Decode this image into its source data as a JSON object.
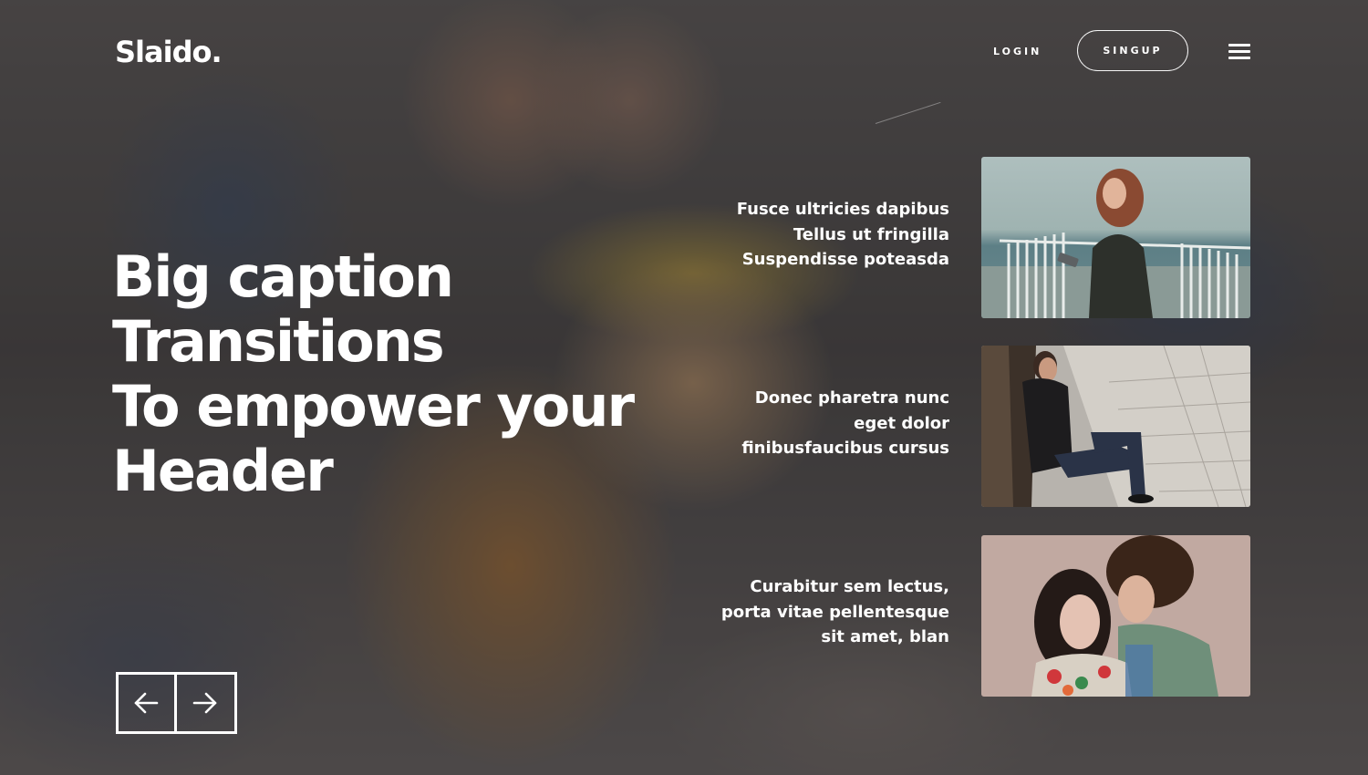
{
  "header": {
    "logo": "Slaido.",
    "login_label": "LOGIN",
    "signup_label": "SINGUP",
    "menu_icon": "hamburger-menu-icon"
  },
  "hero": {
    "lines": [
      "Big caption",
      "Transitions",
      "To empower your",
      "Header"
    ]
  },
  "slides": [
    {
      "caption": [
        "Fusce ultricies dapibus",
        "Tellus ut fringilla",
        "Suspendisse poteasda"
      ],
      "image": "woman-by-sea-photo"
    },
    {
      "caption": [
        "Donec pharetra nunc",
        "eget dolor",
        "finibusfaucibus cursus"
      ],
      "image": "man-sitting-on-pavement-photo"
    },
    {
      "caption": [
        "Curabitur sem lectus,",
        "porta vitae pellentesque",
        "sit amet, blan"
      ],
      "image": "couple-embrace-photo"
    }
  ],
  "navigation": {
    "prev_icon": "arrow-left-icon",
    "next_icon": "arrow-right-icon"
  },
  "colors": {
    "text": "#ffffff",
    "overlay": "#1c1a1e"
  }
}
